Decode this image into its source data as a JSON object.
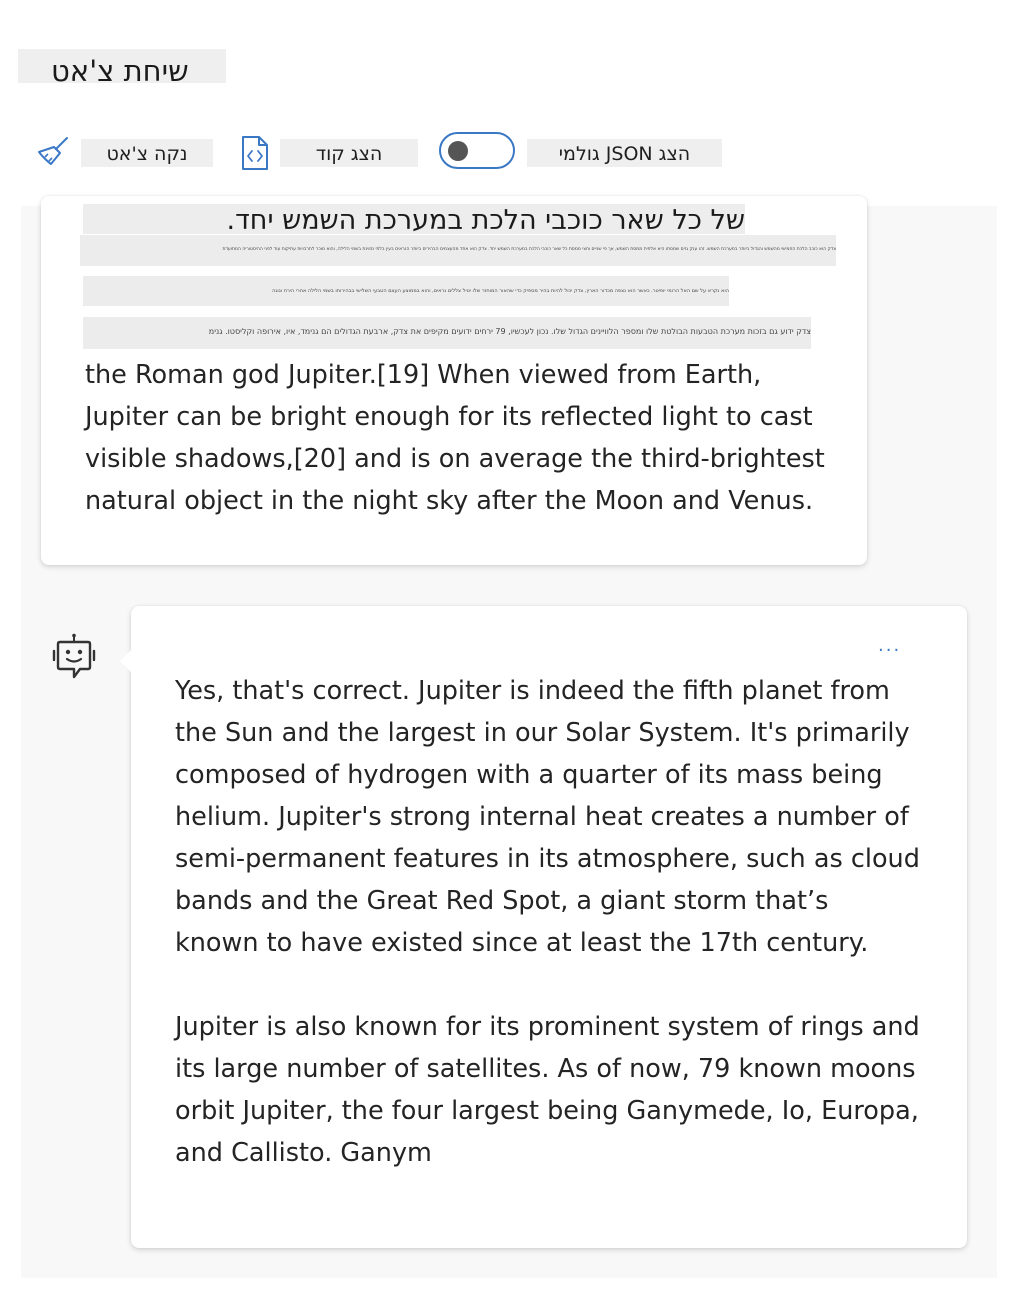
{
  "header": {
    "title": "שיחת צ'אט"
  },
  "toolbar": {
    "clear_chat_label": "נקה צ'אט",
    "clear_chat_icon": "broom-icon",
    "show_code_label": "הצג קוד",
    "show_code_icon": "code-file-icon",
    "raw_json_toggle_on": false,
    "raw_json_label": "הצג JSON גולמי"
  },
  "user_message": {
    "heading": "של כל שאר כוכבי הלכת במערכת השמש יחד.",
    "tiny_line_1": "צדק הוא כוכב הלכת החמישי מהשמש והגדול ביותר במערכת השמש. זהו ענק גזים שמסתו היא אלפית ממסת השמש, אך פי שניים וחצי ממסת כל שאר כוכבי הלכת במערכת השמש יחד. צדק הוא אחד מהעצמים הבהירים ביותר הנראים בעין בלתי מזוינת בשמי הלילה, והוא מוכר לתרבויות עתיקות עוד לפני ההיסטוריה המתועדת",
    "tiny_line_2": "הוא נקרא על שם האל הרומי יופיטר. כאשר הוא נצפה מכדור הארץ, צדק יכול להיות בהיר מספיק כדי שהאור המוחזר שלו יטיל צללים נראים, והוא בממוצע העצם הטבעי השלישי בבהירותו בשמי הלילה אחרי הירח ונוגה",
    "tiny_line_3": "צדק ידוע גם בזכות מערכת הטבעות הבולטת שלו ומספר הלוויינים הגדול שלו. נכון לעכשיו, 79 ירחים ידועים מקיפים את צדק, ארבעת הגדולים הם גנימד, איו, אירופה וקליסטו. גנימ",
    "text": "the Roman god Jupiter.[19] When viewed from Earth, Jupiter can be bright enough for its reflected light to cast visible shadows,[20] and is on average the third-brightest natural object in the night sky after the Moon and Venus."
  },
  "bot_message": {
    "avatar_icon": "bot-icon",
    "more_label": "...",
    "paragraph_1": "Yes, that's correct. Jupiter is indeed the fifth planet from the Sun and the largest in our Solar System. It's primarily composed of hydrogen with a quarter of its mass being helium. Jupiter's strong internal heat creates a number of semi-permanent features in its atmosphere, such as cloud bands and the Great Red Spot, a giant storm that’s known to have existed since at least the 17th century.",
    "paragraph_2": "Jupiter is also known for its prominent system of rings and its large number of satellites. As of now, 79 known moons orbit Jupiter, the four largest being Ganymede, Io, Europa, and Callisto. Ganym"
  },
  "colors": {
    "accent": "#3a78c6",
    "chat_background": "#f8f8f8",
    "label_background": "#efefef"
  }
}
